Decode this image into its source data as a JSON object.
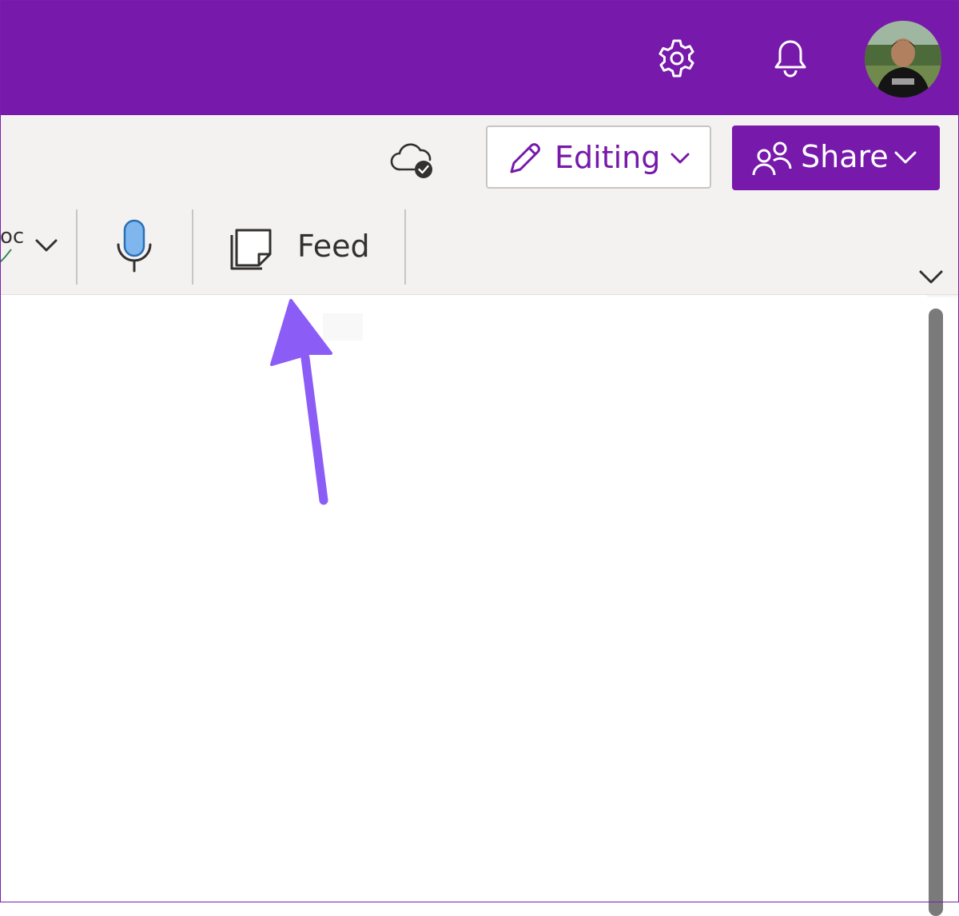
{
  "header": {
    "background_color": "#7719aa",
    "icons": [
      "gear-icon",
      "bell-icon"
    ],
    "avatar_alt": "user-avatar"
  },
  "toolbar": {
    "sync_icon": "cloud-check-icon",
    "editing": {
      "label": "Editing",
      "icon": "pencil-icon"
    },
    "share": {
      "label": "Share",
      "icon": "people-icon"
    }
  },
  "ribbon": {
    "partial_label": "oc",
    "feed": {
      "label": "Feed",
      "icon": "sticky-note-icon"
    },
    "mic_icon": "microphone-icon"
  },
  "annotation": {
    "arrow_color": "#8b5cf6"
  },
  "colors": {
    "accent": "#7719aa",
    "command_bar": "#f3f2f1",
    "scrollbar": "#7a7a7a"
  }
}
